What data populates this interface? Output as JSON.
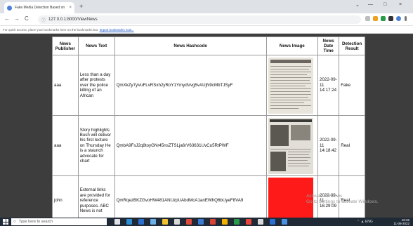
{
  "browser": {
    "tab_title": "Fake Media Detection Based on",
    "tab_close": "×",
    "new_tab": "+",
    "url": "127.0.0.1:8000/ViewNews",
    "back": "←",
    "forward": "→",
    "reload": "C",
    "lock": "ⓘ",
    "minimize": "—",
    "maximize": "□",
    "close": "×",
    "chevron": "⌄"
  },
  "bookmarks_bar": {
    "text": "For quick access, place your bookmarks here on the bookmarks bar.",
    "link": "Import bookmarks now..."
  },
  "table": {
    "headers": [
      "News Publisher",
      "News Text",
      "News Hashcode",
      "News Image",
      "News Date Time",
      "Detection Result"
    ],
    "rows": [
      {
        "publisher": "aaa",
        "text": "Less than a day after protests over the police killing of an African",
        "hashcode": "QmXkZy7yVuFLvRSxh2yRoY1YmydVvg5vAUjN9cMbTJSyF",
        "image": "newspaper-article-image",
        "datetime": "2022-09-11 14:17:24",
        "result": "Fake"
      },
      {
        "publisher": "aaa",
        "text": "Story highlights Bush will deliver his first lecture on Thursday He is a staunch advocate for chart",
        "hashcode": "QmbA9FsJ2q8toyGNr45nsZTSLja6rV63631UvCu5RtPWF",
        "image": "newspaper-photo-image",
        "datetime": "2022-09-11 14:18:42",
        "result": "Real"
      },
      {
        "publisher": "john",
        "text": "External links are provided for reference purposes. ABC News is not",
        "hashcode": "QmRqezBKZGvoHW481ANUzpUAbdMcA1anEWhQ6bUyeF8VA9",
        "image": "red-image",
        "datetime": "2022-09-11 16:29:09",
        "result": "Real"
      }
    ]
  },
  "watermark": {
    "line1": "Activate Windows",
    "line2": "Go to Settings to activate Windows."
  },
  "taskbar": {
    "search_placeholder": "Type here to search",
    "time": "16:32",
    "date": "11-09-2022",
    "tray": "⌃ ▲ ENG"
  },
  "colors": {
    "red_image": "#ff1a1a",
    "taskbar": "#1f2a36",
    "page_bg": "#3d3d3d"
  }
}
